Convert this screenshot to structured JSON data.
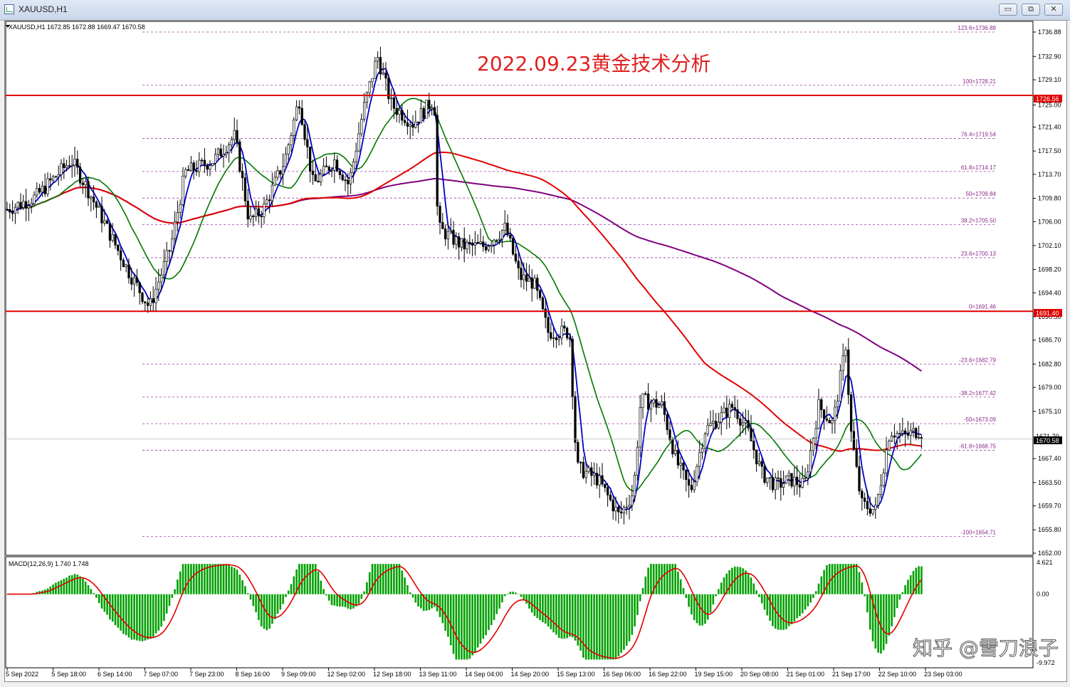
{
  "window": {
    "title": "XAUUSD,H1",
    "buttons": {
      "minimize": "▭",
      "restore": "⧉",
      "close": "✕"
    }
  },
  "main_chart": {
    "header": "XAUUSD,H1  1672.85 1672.88 1669.47 1670.58",
    "headline": "2022.09.23黄金技术分析",
    "current_price": "1670.58",
    "current_price_axis_partial": "1671.70",
    "level_labels": {
      "upper": "1726.56",
      "lower": "1691.40"
    },
    "price_ticks": [
      "1736.88",
      "1732.90",
      "1729.10",
      "1725.00",
      "1721.40",
      "1717.50",
      "1713.70",
      "1709.80",
      "1706.00",
      "1702.10",
      "1698.20",
      "1694.40",
      "1690.50",
      "1686.70",
      "1682.80",
      "1679.00",
      "1675.10",
      "1667.40",
      "1663.50",
      "1659.70",
      "1655.80",
      "1652.00"
    ],
    "fib_levels": [
      "123.6=1736.88",
      "100=1728.21",
      "76.4=1719.54",
      "61.8=1714.17",
      "50=1709.84",
      "38.2=1705.50",
      "23.6=1700.13",
      "0=1691.46",
      "-23.6=1682.79",
      "-38.2=1677.42",
      "-50=1673.09",
      "-61.8=1668.75",
      "-100=1654.71"
    ],
    "time_ticks": [
      "5 Sep 2022",
      "5 Sep 18:00",
      "6 Sep 14:00",
      "7 Sep 07:00",
      "7 Sep 23:00",
      "8 Sep 16:00",
      "9 Sep 09:00",
      "12 Sep 02:00",
      "12 Sep 18:00",
      "13 Sep 11:00",
      "14 Sep 04:00",
      "14 Sep 20:00",
      "15 Sep 13:00",
      "16 Sep 06:00",
      "16 Sep 22:00",
      "19 Sep 15:00",
      "20 Sep 08:00",
      "21 Sep 01:00",
      "21 Sep 17:00",
      "22 Sep 10:00",
      "23 Sep 03:00"
    ]
  },
  "macd": {
    "header": "MACD(12,26,9) 1.740 1.748",
    "ticks": [
      "4.621",
      "0.00",
      "-9.972"
    ]
  },
  "watermark": "知乎 @雪刀浪子",
  "colors": {
    "bull": "#000000",
    "bear": "#000000",
    "ma_fast": "#0000c8",
    "ma_mid": "#007800",
    "ma_slow": "#e00000",
    "ma_long": "#800080",
    "hline": "#e00000",
    "fib": "#a040a0",
    "macd_hist": "#00a000",
    "macd_signal": "#e00000"
  }
}
